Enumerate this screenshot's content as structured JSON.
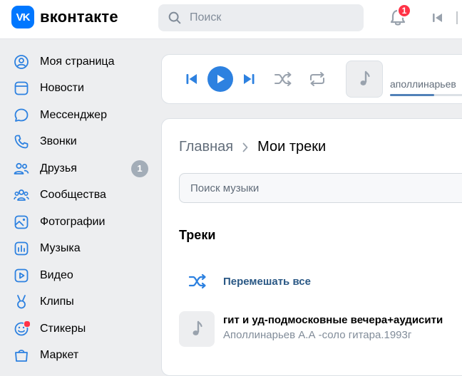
{
  "header": {
    "logo_text": "вконтакте",
    "logo_mark": "VK",
    "search_placeholder": "Поиск",
    "notification_count": "1"
  },
  "sidebar": {
    "items": [
      {
        "label": "Моя страница",
        "icon": "user-circle-icon"
      },
      {
        "label": "Новости",
        "icon": "news-icon"
      },
      {
        "label": "Мессенджер",
        "icon": "message-icon"
      },
      {
        "label": "Звонки",
        "icon": "phone-icon"
      },
      {
        "label": "Друзья",
        "icon": "friends-icon",
        "badge": "1"
      },
      {
        "label": "Сообщества",
        "icon": "communities-icon"
      },
      {
        "label": "Фотографии",
        "icon": "photo-icon"
      },
      {
        "label": "Музыка",
        "icon": "music-icon"
      },
      {
        "label": "Видео",
        "icon": "video-icon"
      },
      {
        "label": "Клипы",
        "icon": "clips-icon"
      },
      {
        "label": "Стикеры",
        "icon": "stickers-icon"
      },
      {
        "label": "Маркет",
        "icon": "market-icon"
      }
    ]
  },
  "player": {
    "track_title": "аполлинарьев",
    "progress": 0.52
  },
  "main": {
    "breadcrumb_home": "Главная",
    "breadcrumb_current": "Мои треки",
    "search_placeholder": "Поиск музыки",
    "tracks_heading": "Треки",
    "shuffle_label": "Перемешать все",
    "track": {
      "name": "гит и уд-подмосковные вечера+аудисити",
      "artist": "Аполлинарьев А.А -соло гитара.1993г"
    }
  },
  "colors": {
    "accent": "#2d81e0",
    "link": "#2a5885",
    "badge_red": "#ff3347",
    "logo_blue": "#0077ff"
  }
}
